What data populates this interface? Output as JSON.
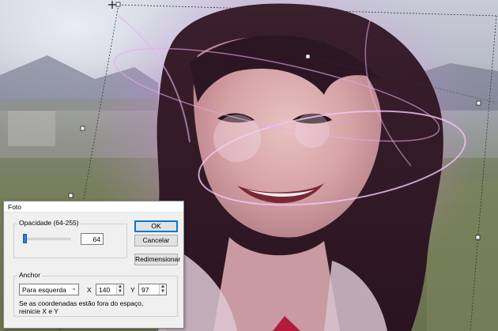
{
  "dialog": {
    "title": "Foto",
    "opacity": {
      "group_label": "Opacidade (64-255)",
      "value": "64",
      "slider_level": 0.0
    },
    "buttons": {
      "ok": "OK",
      "cancel": "Cancelar",
      "resize": "Redimensionar"
    },
    "anchor": {
      "group_label": "Anchor",
      "selected": "Para esquerda",
      "x_label": "X",
      "x_value": "140",
      "y_label": "Y",
      "y_value": "97",
      "note": "Se as coordenadas estão fora do espaço, reinicie X e Y"
    }
  },
  "colors": {
    "accent": "#0078d7",
    "slider": "#2f7bd1",
    "glow": "#c66ad6"
  },
  "icons": [
    "move-cross-icon",
    "rotate-handle-icon",
    "chevron-down-icon",
    "spin-up-icon",
    "spin-down-icon"
  ]
}
